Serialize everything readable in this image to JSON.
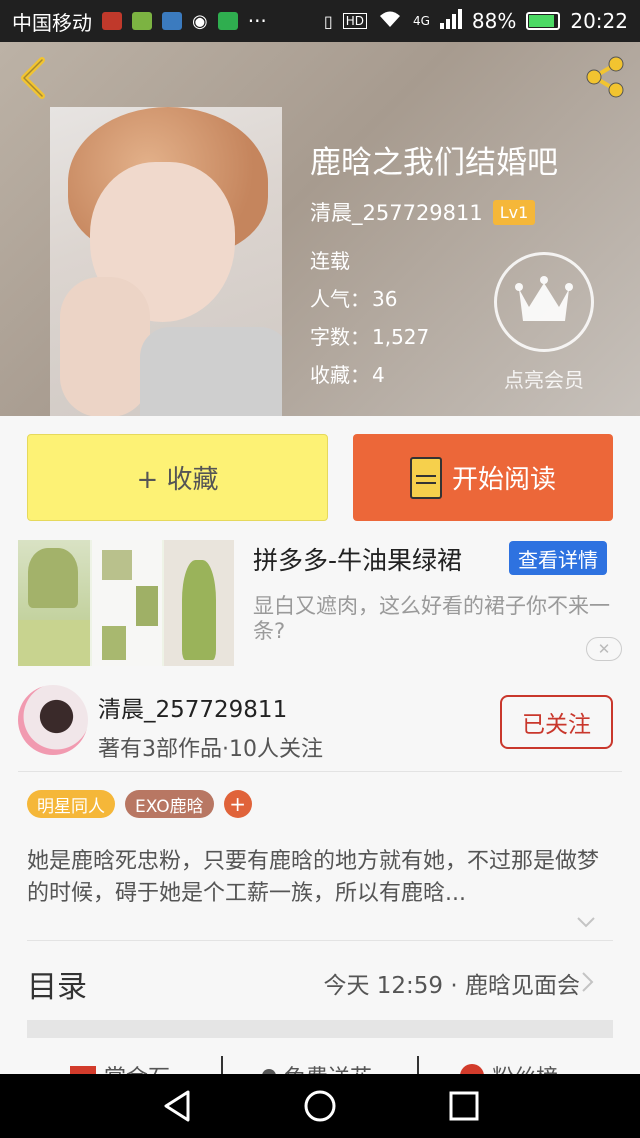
{
  "status_bar": {
    "carrier": "中国移动",
    "network": "4G",
    "battery": "88%",
    "time": "20:22"
  },
  "book": {
    "title": "鹿晗之我们结婚吧",
    "author": "清晨_257729811",
    "level": "Lv1",
    "status": "连载",
    "popularity_label": "人气：",
    "popularity": "36",
    "wordcount_label": "字数：",
    "wordcount": "1,527",
    "favorites_label": "收藏：",
    "favorites": "4",
    "vip_label": "点亮会员"
  },
  "actions": {
    "collect_label": "+ 收藏",
    "read_label": "开始阅读"
  },
  "ad": {
    "title": "拼多多-牛油果绿裙",
    "button": "查看详情",
    "description": "显白又遮肉，这么好看的裙子你不来一条?"
  },
  "author_section": {
    "name": "清晨_257729811",
    "stats": "著有3部作品·10人关注",
    "follow_label": "已关注"
  },
  "tags": [
    {
      "label": "明星同人",
      "color": "#f5b739"
    },
    {
      "label": "EXO鹿晗",
      "color": "#b87763"
    }
  ],
  "tag_add": "+",
  "description": "她是鹿晗死忠粉，只要有鹿晗的地方就有她，不过那是做梦的时候，碍于她是个工薪一族，所以有鹿晗...",
  "toc": {
    "label": "目录",
    "latest": "今天 12:59 · 鹿晗见面会"
  },
  "bottom_items": [
    "赏金石",
    "免费送花",
    "粉丝榜"
  ],
  "colors": {
    "accent_orange": "#ec6739",
    "collect_yellow": "#fdf275",
    "follow_red": "#c9372c",
    "ad_blue": "#2e72e0"
  }
}
